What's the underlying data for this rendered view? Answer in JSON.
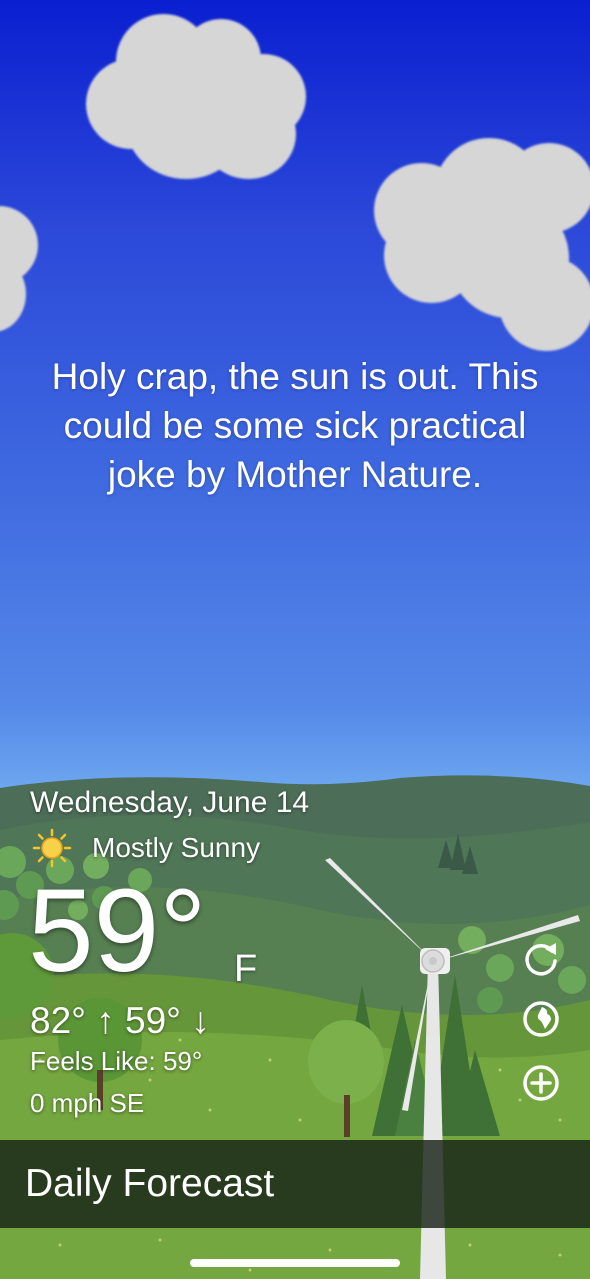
{
  "message": "Holy crap, the sun is out. This could be some sick practical joke by Mother Nature.",
  "weather": {
    "date": "Wednesday, June 14",
    "condition": "Mostly Sunny",
    "condition_icon": "sun-icon",
    "temperature": "59°",
    "unit": "F",
    "high": "82°",
    "low": "59°",
    "high_arrow": "↑",
    "low_arrow": "↓",
    "feels_like": "Feels Like: 59°",
    "wind": "0 mph SE"
  },
  "actions": [
    {
      "name": "refresh",
      "icon": "refresh-icon"
    },
    {
      "name": "location",
      "icon": "globe-icon"
    },
    {
      "name": "add",
      "icon": "plus-circle-icon"
    }
  ],
  "footer": {
    "daily_forecast_label": "Daily Forecast"
  },
  "colors": {
    "sky_top": "#0a1fd0",
    "sky_bottom": "#6ea8f0",
    "hill_far": "#4a6e55",
    "grass": "#6b9a3a",
    "cloud": "#d6d6d6",
    "bar": "#19231a"
  }
}
